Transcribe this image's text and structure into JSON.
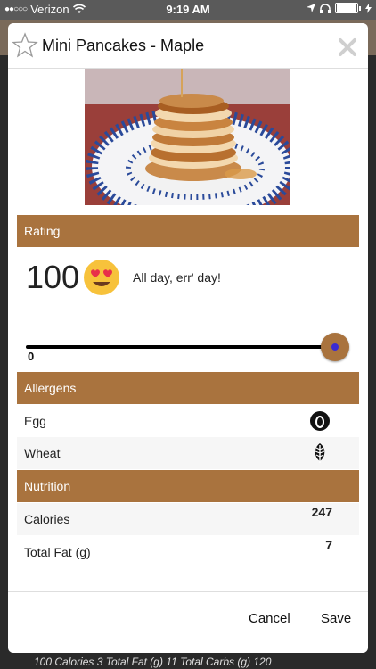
{
  "status_bar": {
    "carrier": "Verizon",
    "time": "9:19 AM"
  },
  "modal": {
    "title": "Mini Pancakes - Maple",
    "rating": {
      "header": "Rating",
      "value": "100",
      "message": "All day, err' day!",
      "slider_min_label": "0",
      "slider_level_percent": 100
    },
    "allergens": {
      "header": "Allergens",
      "items": [
        {
          "label": "Egg",
          "icon": "egg-icon"
        },
        {
          "label": "Wheat",
          "icon": "wheat-leaf-icon"
        }
      ]
    },
    "nutrition": {
      "header": "Nutrition",
      "items": [
        {
          "label": "Calories",
          "value": "247"
        },
        {
          "label": "Total Fat (g)",
          "value": "7"
        }
      ]
    },
    "buttons": {
      "cancel": "Cancel",
      "save": "Save"
    }
  },
  "background_footer": "100 Calories   3 Total Fat (g)   11 Total Carbs (g)   120",
  "colors": {
    "accent": "#a9733e",
    "slider_dot": "#3b2bd0"
  }
}
